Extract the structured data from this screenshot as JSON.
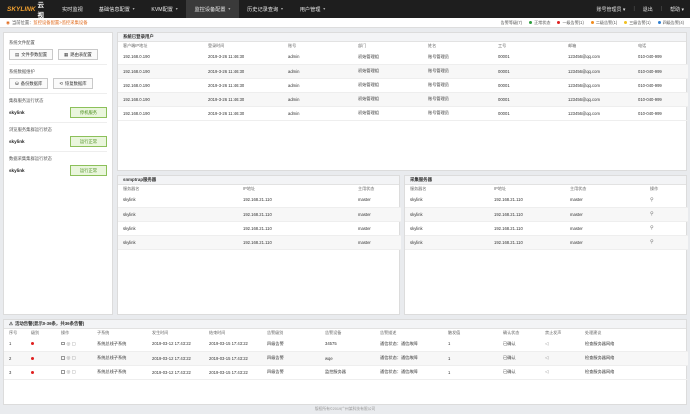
{
  "brand": {
    "logo_mark": "SKYLINK",
    "logo_text": "云视"
  },
  "nav": [
    {
      "label": "实时监视",
      "has_dropdown": false
    },
    {
      "label": "基础信息配置",
      "has_dropdown": true
    },
    {
      "label": "KVM配置",
      "has_dropdown": true
    },
    {
      "label": "监控设备配置",
      "has_dropdown": true
    },
    {
      "label": "历史记录查询",
      "has_dropdown": true
    },
    {
      "label": "用户管理",
      "has_dropdown": true
    }
  ],
  "user_menu": {
    "user": "账号管理员",
    "logout": "退出",
    "help": "帮助"
  },
  "breadcrumb": {
    "prefix": "当前位置：",
    "level1": "监控设备配置",
    "sep": " > ",
    "level2": "监控采集设备"
  },
  "legend": {
    "title": "告警等级(7)",
    "items": [
      {
        "label": "正常状态",
        "color": "#2e9e3e"
      },
      {
        "label": "一级告警(1)",
        "color": "#e02020"
      },
      {
        "label": "二级告警(1)",
        "color": "#f08c1e"
      },
      {
        "label": "三级告警(1)",
        "color": "#f0c020"
      },
      {
        "label": "四级告警(4)",
        "color": "#2f7fd0"
      }
    ]
  },
  "left": {
    "sec1_title": "系统文件配置",
    "sec1_btn1": "文件参数配置",
    "sec1_btn2": "路由表配置",
    "sec2_title": "系统数据维护",
    "sec2_btn1": "备份数据库",
    "sec2_btn2": "恢复数据库",
    "sec3_title": "集群服务运行状态",
    "sec3_name": "skylink",
    "sec3_btn": "停机服务",
    "sec4_title": "浏览服务集群运行状态",
    "sec4_name": "skylink",
    "sec4_btn": "运行正常",
    "sec5_title": "数据采集集群运行状态",
    "sec5_name": "skylink",
    "sec5_btn": "运行正常"
  },
  "users": {
    "title": "系统已登录用户",
    "columns": [
      "客户端IP地址",
      "登录时间",
      "账号",
      "部门",
      "姓名",
      "工号",
      "邮箱",
      "电话"
    ],
    "rows": [
      [
        "192.168.0.190",
        "2019-3-26 11:46:30",
        "admin",
        "初始管理组",
        "账号管理员",
        "00001",
        "123456@qq.com",
        "010-040-999"
      ],
      [
        "192.168.0.190",
        "2019-3-26 11:46:30",
        "admin",
        "初始管理组",
        "账号管理员",
        "00001",
        "123456@qq.com",
        "010-040-999"
      ],
      [
        "192.168.0.190",
        "2019-3-26 11:46:30",
        "admin",
        "初始管理组",
        "账号管理员",
        "00001",
        "123456@qq.com",
        "010-040-999"
      ],
      [
        "192.168.0.190",
        "2019-3-26 11:46:30",
        "admin",
        "初始管理组",
        "账号管理员",
        "00001",
        "123456@qq.com",
        "010-040-999"
      ],
      [
        "192.168.0.190",
        "2019-3-26 11:46:30",
        "admin",
        "初始管理组",
        "账号管理员",
        "00001",
        "123456@qq.com",
        "010-040-999"
      ]
    ]
  },
  "snmp": {
    "title": "snmptrap服务器",
    "columns": [
      "服务器名",
      "IP地址",
      "主用状态"
    ],
    "rows": [
      [
        "skylink",
        "192.168.21.110",
        "master"
      ],
      [
        "skylink",
        "192.168.21.110",
        "master"
      ],
      [
        "skylink",
        "192.168.21.110",
        "master"
      ],
      [
        "skylink",
        "192.168.21.110",
        "master"
      ]
    ]
  },
  "collectors": {
    "title": "采集服务器",
    "columns": [
      "服务器名",
      "IP地址",
      "主用状态",
      "操作"
    ],
    "rows": [
      [
        "skylink",
        "192.168.21.110",
        "master"
      ],
      [
        "skylink",
        "192.168.21.110",
        "master"
      ],
      [
        "skylink",
        "192.168.21.110",
        "master"
      ],
      [
        "skylink",
        "192.168.21.110",
        "master"
      ]
    ]
  },
  "alarms": {
    "title": "活动告警(显示0-36条，共36条告警)",
    "columns": [
      "序号",
      "级别",
      "操作",
      "",
      "子系统",
      "发生时间",
      "结束时间",
      "告警级别",
      "告警设备",
      "告警描述",
      "触发值",
      "确认状态",
      "禁止发声",
      "处理建议"
    ],
    "rows": [
      [
        "1",
        "系统总线子系统",
        "2019-03-12 17:43:22",
        "2019-03-15 17:43:22",
        "四级告警",
        "34575",
        "通信状态：通信故障",
        "1",
        "已确认",
        "检查服务器网络"
      ],
      [
        "2",
        "系统总线子系统",
        "2019-03-12 17:43:22",
        "2019-03-15 17:43:22",
        "四级告警",
        "wqe",
        "通信状态：通信故障",
        "1",
        "已确认",
        "检查服务器网络"
      ],
      [
        "3",
        "系统总线子系统",
        "2019-03-12 17:43:22",
        "2019-03-15 17:43:22",
        "四级告警",
        "监控服务器",
        "通信状态：通信故障",
        "1",
        "已确认",
        "检查服务器网络"
      ]
    ]
  },
  "footer": "版权所有©2019广州某科技有限公司"
}
